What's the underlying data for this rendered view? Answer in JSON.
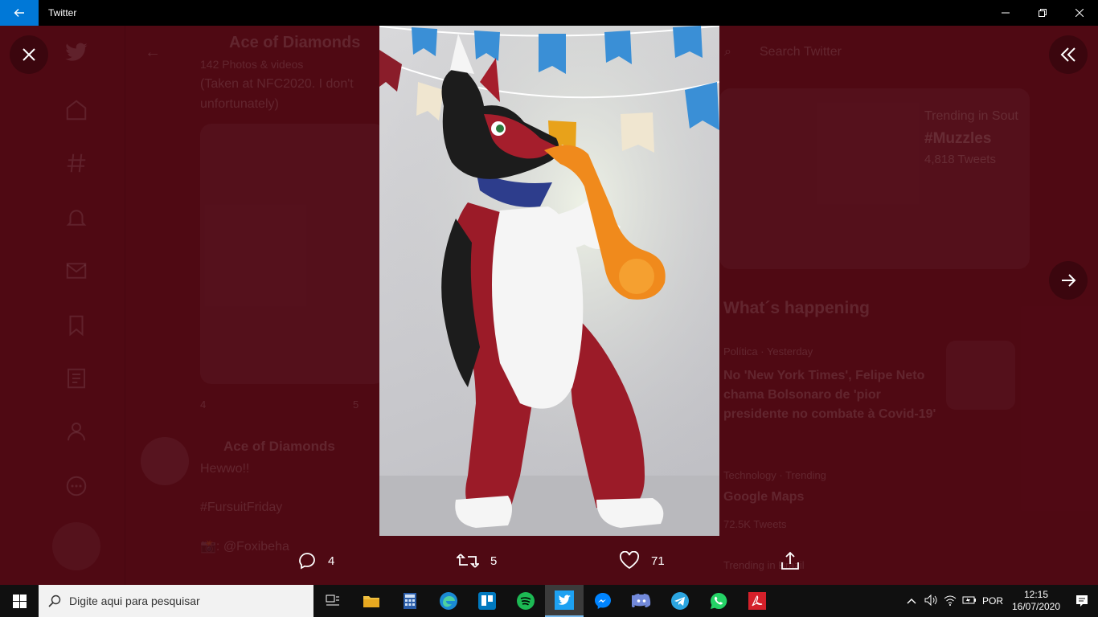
{
  "window": {
    "title": "Twitter"
  },
  "profile": {
    "name": "Ace of Diamonds",
    "subtitle": "142 Photos & videos",
    "tweet_text_1": "(Taken at NFC2020. I don't",
    "tweet_text_2": "unfortunately)",
    "reply_count_bg": "4",
    "retweet_count_bg": "5",
    "tweet2_name": "Ace of Diamonds",
    "tweet2_line1": "Hewwo!!",
    "tweet2_line2": "#FursuitFriday",
    "tweet2_line3": "📸: @Foxibeha"
  },
  "sidebar_right": {
    "search_placeholder": "Search Twitter",
    "trend_card_label": "Trending in Sout",
    "trend_card_tag": "#Muzzles",
    "trend_card_count": "4,818 Tweets",
    "section_title": "What´s happening",
    "items": [
      {
        "meta": "Política · Yesterday",
        "title": "No 'New York Times', Felipe Neto chama Bolsonaro de 'pior presidente no combate à Covid-19'"
      },
      {
        "meta": "Technology · Trending",
        "title": "Google Maps",
        "count": "72.5K Tweets"
      },
      {
        "meta": "Trending in Brazil",
        "title": ""
      }
    ]
  },
  "media_viewer": {
    "photo_subject": "red and white dog fursuit playing an inflatable saxophone",
    "actions": {
      "reply_count": "4",
      "retweet_count": "5",
      "like_count": "71"
    }
  },
  "taskbar": {
    "search_placeholder": "Digite aqui para pesquisar",
    "language": "POR",
    "time": "12:15",
    "date": "16/07/2020",
    "apps": [
      "task-view",
      "file-explorer",
      "calculator",
      "edge",
      "trello",
      "spotify",
      "twitter",
      "messenger",
      "discord",
      "telegram",
      "whatsapp",
      "acrobat"
    ]
  },
  "colors": {
    "accent": "#0078d7",
    "backdrop": "#5a0e1a",
    "twitter_blue": "#1da1f2"
  }
}
